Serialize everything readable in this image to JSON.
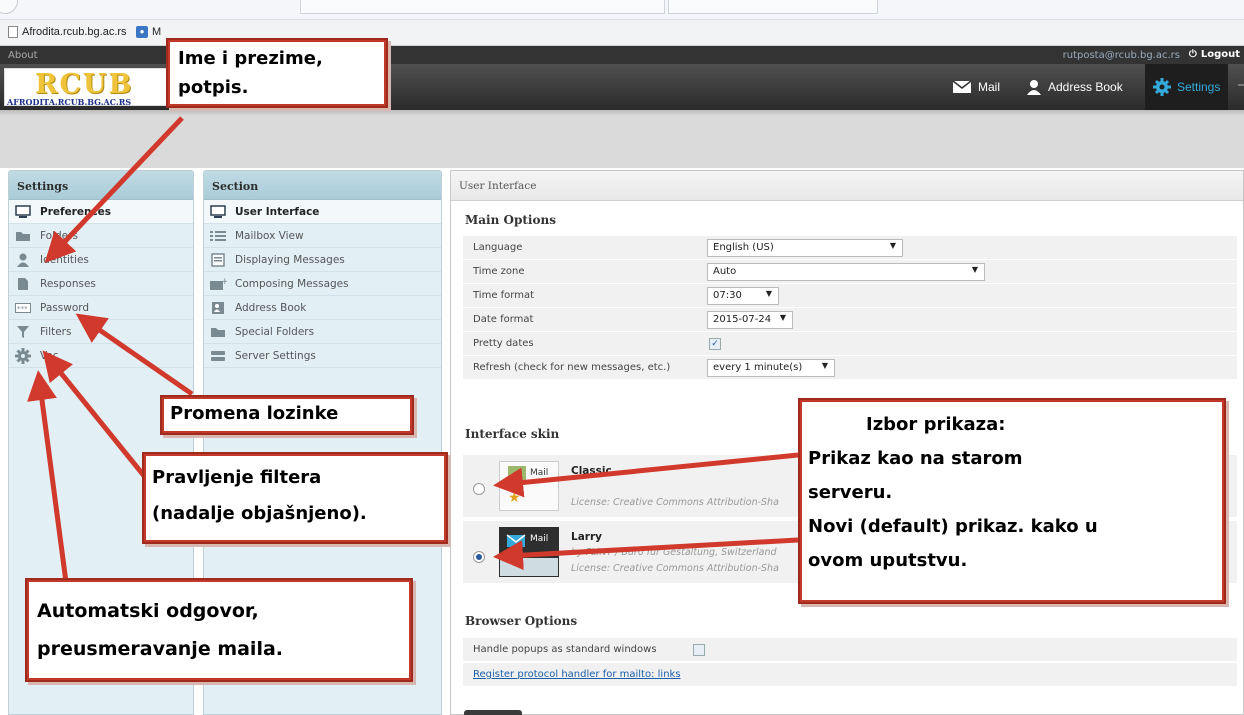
{
  "browser": {
    "bookmarks": [
      {
        "label": "Afrodita.rcub.bg.ac.rs",
        "icon": "page-icon"
      },
      {
        "label": "M",
        "icon": "globe-icon"
      }
    ]
  },
  "topline": {
    "about": "About",
    "user": "rutposta@rcub.bg.ac.rs",
    "logout": "Logout"
  },
  "logo": {
    "big": "RCUB",
    "small": "AFRODITA.RCUB.BG.AC.RS"
  },
  "nav": [
    {
      "label": "Mail",
      "icon": "envelope-icon"
    },
    {
      "label": "Address Book",
      "icon": "person-icon"
    },
    {
      "label": "Settings",
      "icon": "gear-icon",
      "active": true
    }
  ],
  "settings_panel": {
    "title": "Settings",
    "items": [
      {
        "label": "Preferences",
        "icon": "monitor-icon"
      },
      {
        "label": "Folders",
        "icon": "folder-icon"
      },
      {
        "label": "Identities",
        "icon": "person-icon"
      },
      {
        "label": "Responses",
        "icon": "document-icon"
      },
      {
        "label": "Password",
        "icon": "password-icon"
      },
      {
        "label": "Filters",
        "icon": "funnel-icon"
      },
      {
        "label": "Vac",
        "icon": "gear-icon"
      }
    ]
  },
  "section_panel": {
    "title": "Section",
    "items": [
      {
        "label": "User Interface",
        "icon": "monitor-icon"
      },
      {
        "label": "Mailbox View",
        "icon": "list-icon"
      },
      {
        "label": "Displaying Messages",
        "icon": "message-icon"
      },
      {
        "label": "Composing Messages",
        "icon": "compose-icon"
      },
      {
        "label": "Address Book",
        "icon": "addressbook-icon"
      },
      {
        "label": "Special Folders",
        "icon": "folder-icon"
      },
      {
        "label": "Server Settings",
        "icon": "server-icon"
      }
    ]
  },
  "content": {
    "header": "User Interface",
    "main_options_title": "Main Options",
    "options": [
      {
        "label": "Language",
        "value": "English (US)"
      },
      {
        "label": "Time zone",
        "value": "Auto"
      },
      {
        "label": "Time format",
        "value": "07:30"
      },
      {
        "label": "Date format",
        "value": "2015-07-24"
      },
      {
        "label": "Pretty dates",
        "checked": true
      },
      {
        "label": "Refresh (check for new messages, etc.)",
        "value": "every 1 minute(s)"
      }
    ],
    "interface_skin_title": "Interface skin",
    "skins": [
      {
        "name": "Classic",
        "thumb_label": "Mail",
        "license": "License: Creative Commons Attribution-Sha",
        "selected": false
      },
      {
        "name": "Larry",
        "thumb_label": "Mail",
        "author": "by FLINT / Büro für Gestaltung, Switzerland",
        "license": "License: Creative Commons Attribution-Sha",
        "selected": true
      }
    ],
    "browser_options_title": "Browser Options",
    "handle_popups_label": "Handle popups as standard windows",
    "register_link": "Register protocol handler for mailto: links"
  },
  "annotations": {
    "name_signature": [
      "Ime i prezime,",
      "potpis."
    ],
    "password_change": "Promena lozinke",
    "filters": [
      "Pravljenje filtera",
      "(nadalje objašnjeno)."
    ],
    "auto_reply": [
      "Automatski odgovor,",
      "preusmeravanje maila."
    ],
    "skin_choice": [
      "Izbor prikaza:",
      "Prikaz kao na starom",
      "serveru.",
      "Novi (default) prikaz. kako u",
      "ovom uputstvu."
    ]
  },
  "colors": {
    "accent": "#34aadc",
    "panel": "#e2eff4",
    "annotation_border": "#a02a1c",
    "arrow": "#d0392b"
  }
}
